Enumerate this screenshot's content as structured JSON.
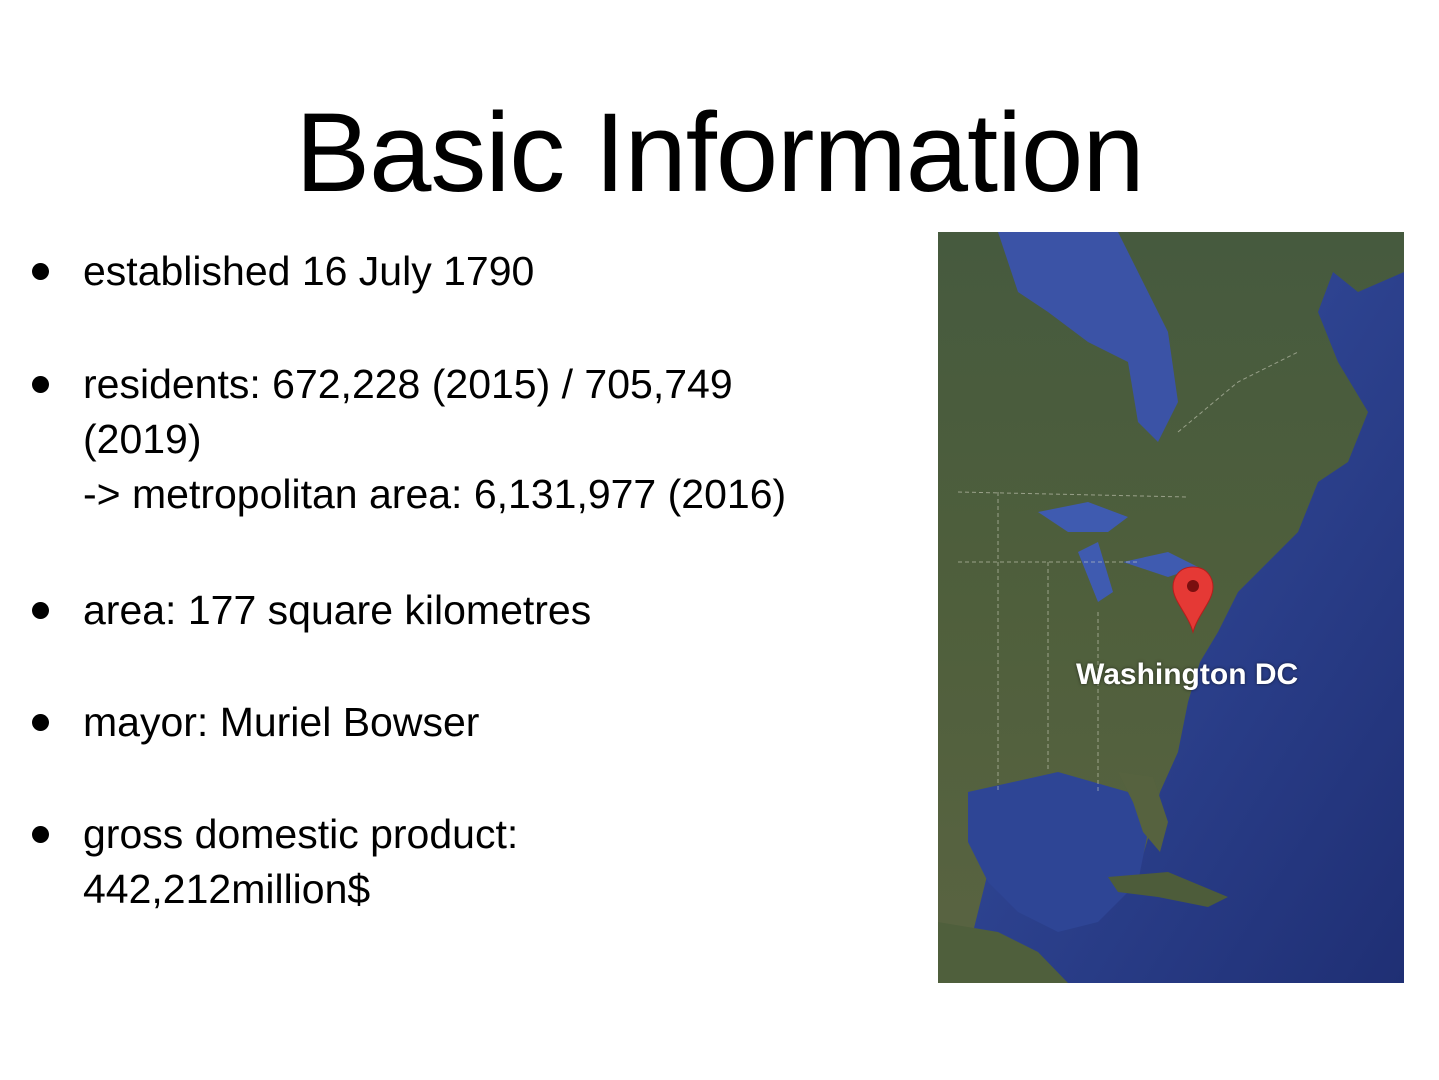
{
  "slide": {
    "title": "Basic Information",
    "bullets": [
      {
        "lines": [
          "established 16 July 1790"
        ]
      },
      {
        "lines": [
          "residents: 672,228 (2015) / 705,749",
          "(2019)",
          "-> metropolitan area: 6,131,977 (2016)"
        ]
      },
      {
        "lines": [
          "area: 177 square kilometres"
        ]
      },
      {
        "lines": [
          "mayor: Muriel Bowser"
        ]
      },
      {
        "lines": [
          "gross domestic product:",
          "442,212million$"
        ]
      }
    ]
  },
  "map": {
    "marker_label": "Washington DC",
    "marker_icon": "map-pin-icon",
    "colors": {
      "ocean": "#2a3f8c",
      "land": "#4a5a3c",
      "marker": "#e53935",
      "label": "#ffffff"
    }
  }
}
